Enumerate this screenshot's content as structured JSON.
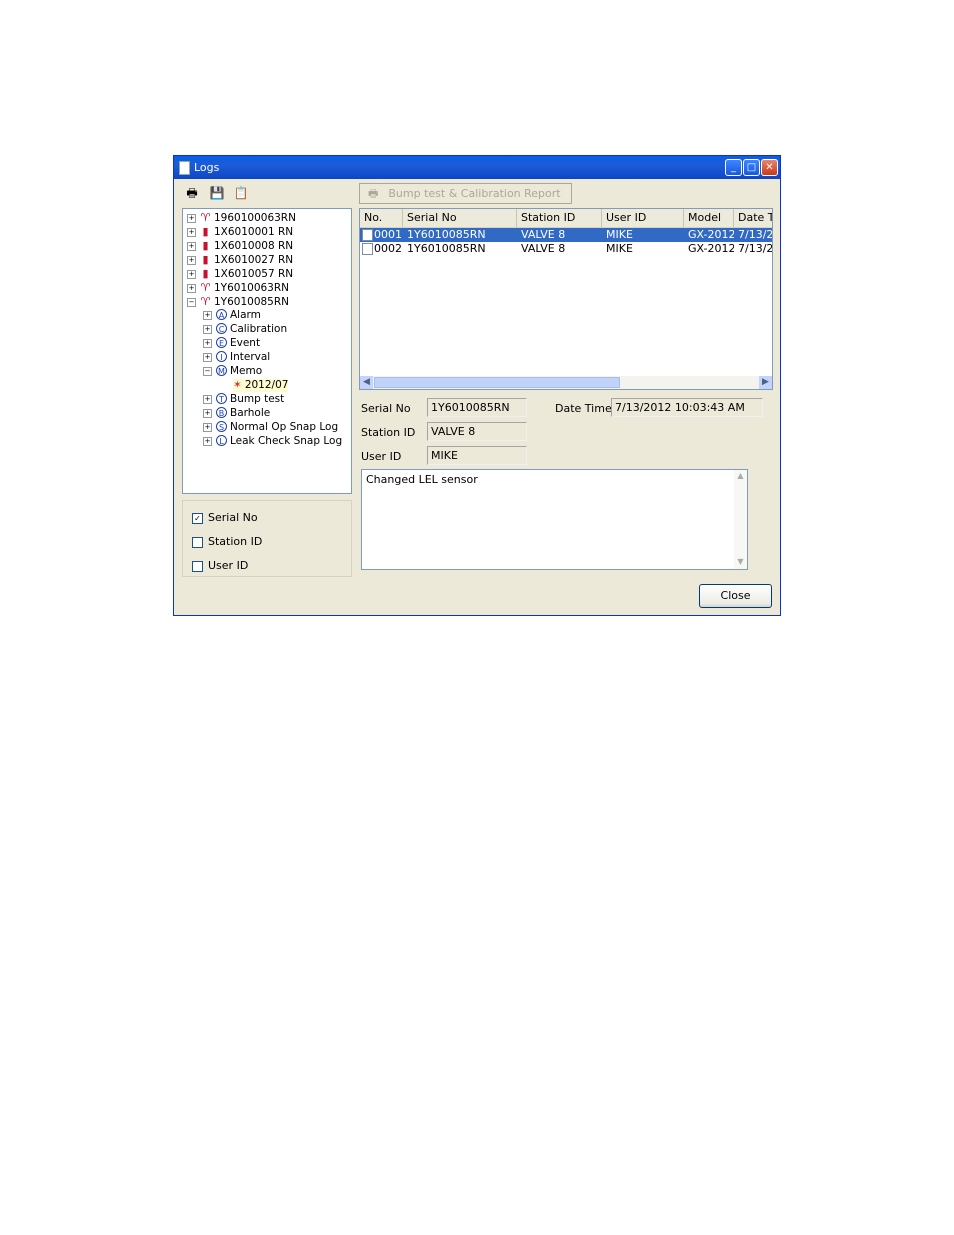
{
  "window": {
    "title": "Logs",
    "buttons": {
      "minimize": "_",
      "maximize": "□",
      "close": "✕"
    }
  },
  "toolbar": {
    "report_label": "Bump test & Calibration Report"
  },
  "tree": {
    "instruments": [
      "1960100063RN",
      "1X6010001 RN",
      "1X6010008 RN",
      "1X6010027 RN",
      "1X6010057 RN",
      "1Y6010063RN",
      "1Y6010085RN"
    ],
    "categories": [
      {
        "letter": "A",
        "label": "Alarm"
      },
      {
        "letter": "C",
        "label": "Calibration"
      },
      {
        "letter": "E",
        "label": "Event"
      },
      {
        "letter": "I",
        "label": "Interval"
      },
      {
        "letter": "M",
        "label": "Memo"
      },
      {
        "letter": "T",
        "label": "Bump test"
      },
      {
        "letter": "B",
        "label": "Barhole"
      },
      {
        "letter": "S",
        "label": "Normal Op Snap Log"
      },
      {
        "letter": "L",
        "label": "Leak Check Snap Log"
      }
    ],
    "memo_child": "2012/07"
  },
  "filters": [
    {
      "label": "Serial No",
      "checked": "✓"
    },
    {
      "label": "Station ID",
      "checked": ""
    },
    {
      "label": "User ID",
      "checked": ""
    }
  ],
  "table": {
    "columns": [
      "No.",
      "Serial No",
      "Station ID",
      "User ID",
      "Model",
      "Date T"
    ],
    "rows": [
      {
        "no": "0001",
        "serial": "1Y6010085RN",
        "station": "VALVE 8",
        "user": "MIKE",
        "model": "GX-2012",
        "date": "7/13/2"
      },
      {
        "no": "0002",
        "serial": "1Y6010085RN",
        "station": "VALVE 8",
        "user": "MIKE",
        "model": "GX-2012",
        "date": "7/13/2"
      }
    ]
  },
  "detail": {
    "serial_label": "Serial No",
    "serial_value": "1Y6010085RN",
    "datetime_label": "Date Time",
    "datetime_value": "7/13/2012 10:03:43 AM",
    "station_label": "Station ID",
    "station_value": "VALVE 8",
    "user_label": "User ID",
    "user_value": "MIKE",
    "memo_text": "Changed LEL sensor"
  },
  "footer": {
    "close_label": "Close"
  },
  "colors": {
    "selection": "#316ac5",
    "title_bar": "#0a5fe6",
    "window_bg": "#ece9d8"
  }
}
